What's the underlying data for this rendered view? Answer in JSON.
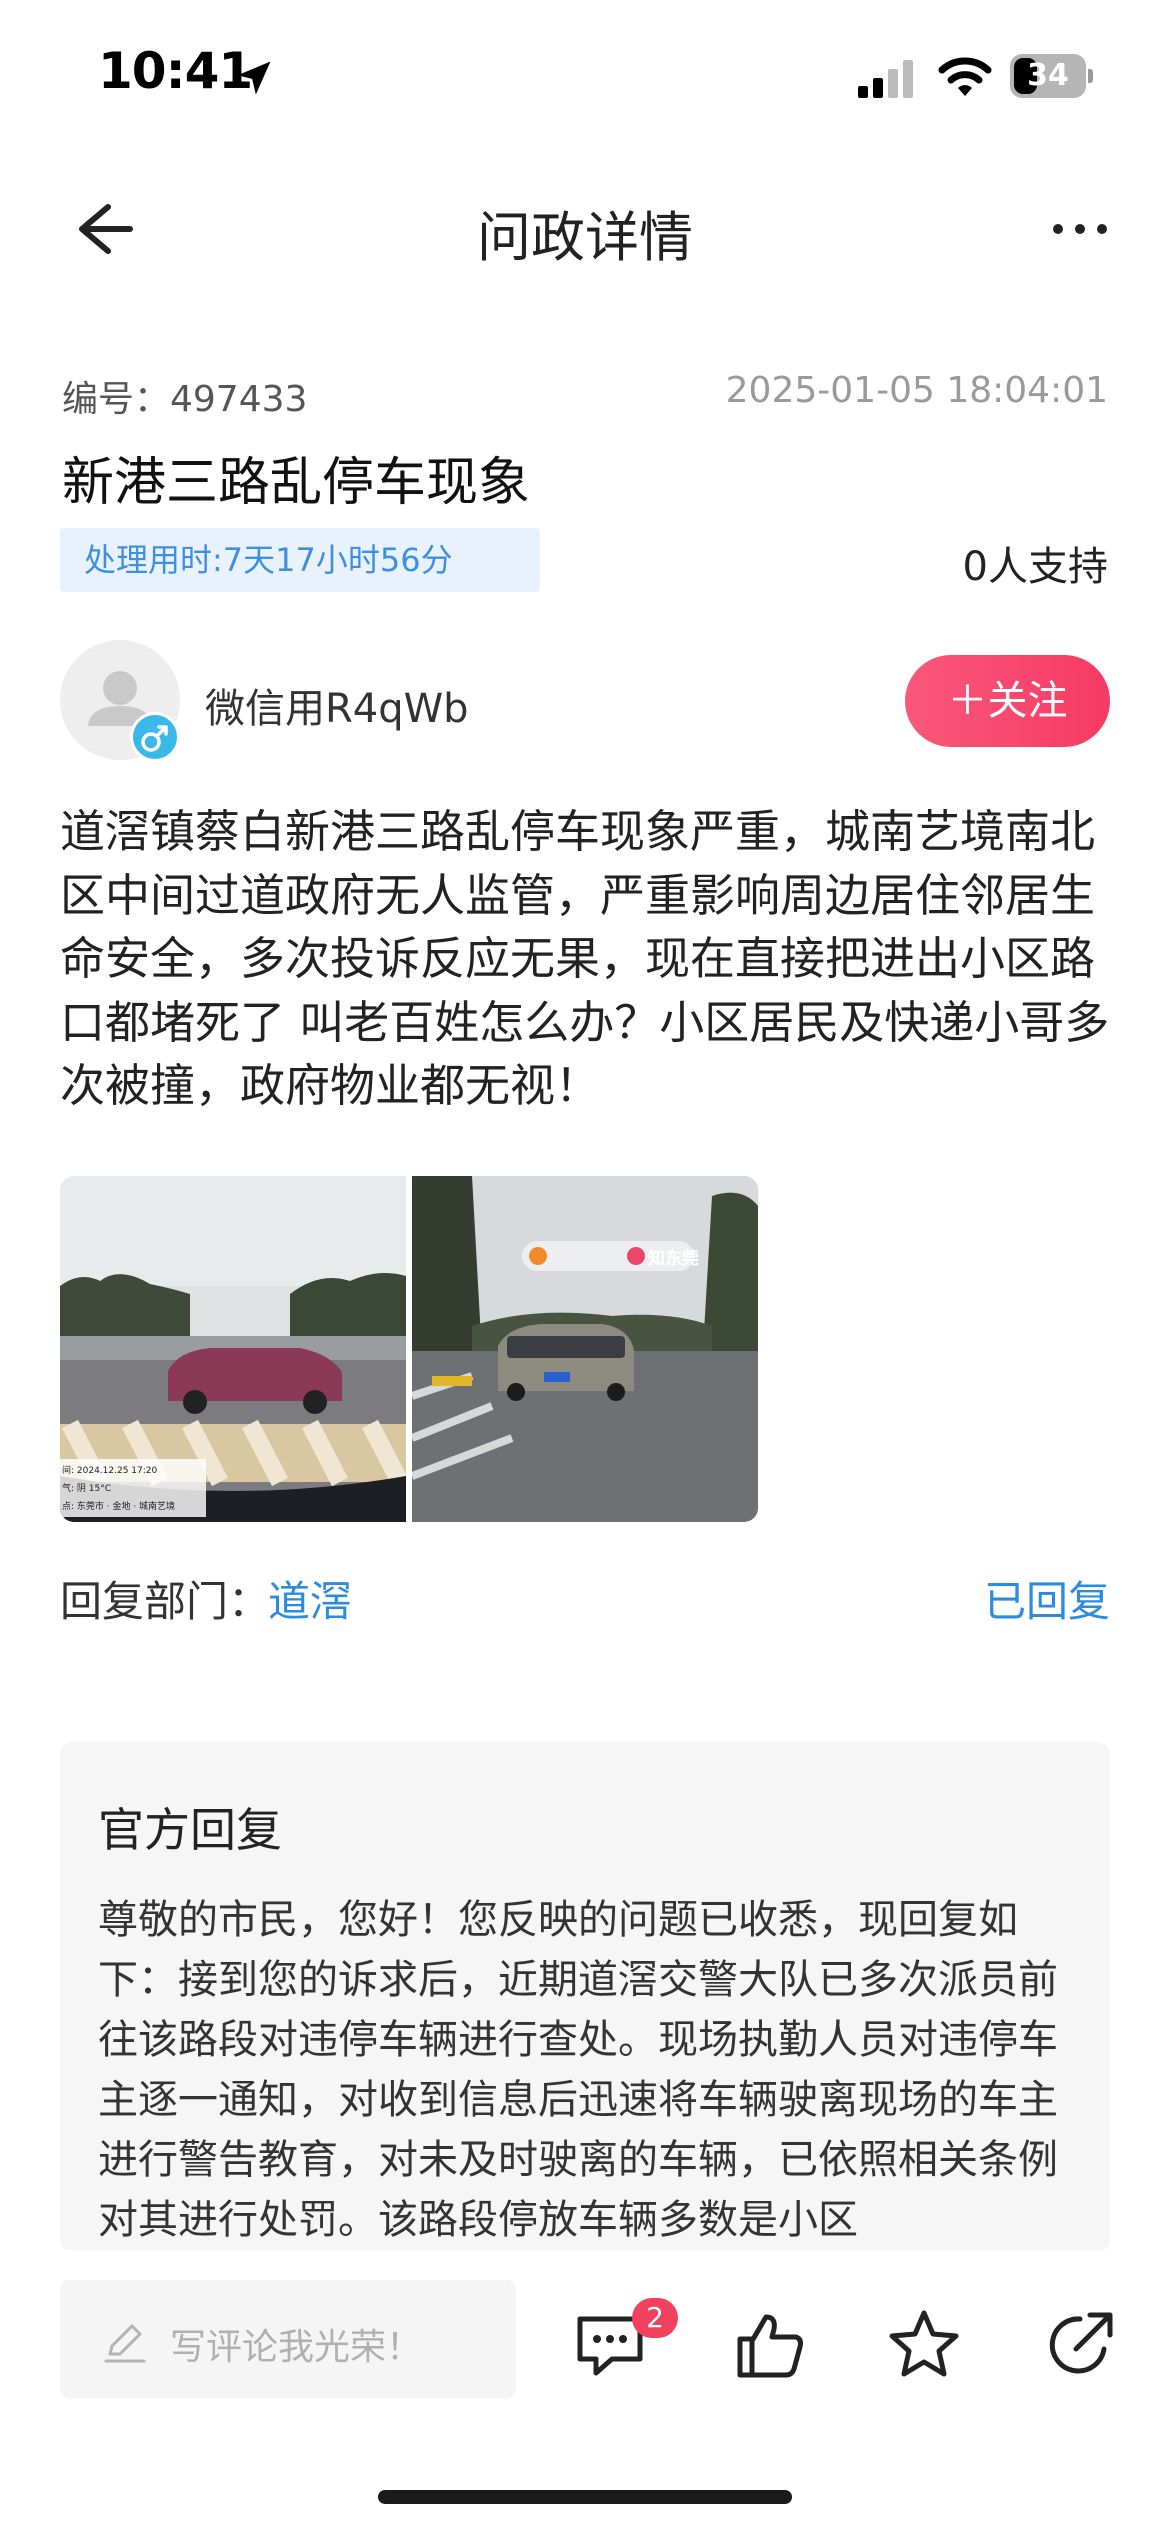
{
  "status_bar": {
    "time": "10:41",
    "battery_level": "34",
    "battery_fraction": 0.34
  },
  "nav": {
    "title": "问政详情"
  },
  "post": {
    "id_text": "编号：497433",
    "datetime": "2025-01-05 18:04:01",
    "title": "新港三路乱停车现象",
    "duration": "处理用时:7天17小时56分",
    "supporters": "0人支持",
    "author": {
      "name": "微信用R4qWb",
      "gender_icon": "male-icon"
    },
    "follow_label": "＋关注",
    "body": "道滘镇蔡白新港三路乱停车现象严重，城南艺境南北区中间过道政府无人监管，严重影响周边居住邻居生命安全，多次投诉反应无果，现在直接把进出小区路口都堵死了 叫老百姓怎么办？小区居民及快递小哥多次被撞，政府物业都无视！",
    "photos": [
      {
        "name": "photo-red-car",
        "caption_lines": [
          "间: 2024.12.25 17:20",
          "气: 阴 15°C",
          "点: 东莞市 · 金地 · 城南艺境"
        ]
      },
      {
        "name": "photo-silver-car",
        "watermark": "知东莞"
      }
    ]
  },
  "department": {
    "label": "回复部门：",
    "value": "道滘",
    "status": "已回复"
  },
  "official_reply": {
    "title": "官方回复",
    "body": "尊敬的市民，您好！您反映的问题已收悉，现回复如下：接到您的诉求后，近期道滘交警大队已多次派员前往该路段对违停车辆进行查处。现场执勤人员对违停车主逐一通知，对收到信息后迅速将车辆驶离现场的车主进行警告教育，对未及时驶离的车辆，已依照相关条例对其进行处罚。该路段停放车辆多数是小区"
  },
  "bottom_bar": {
    "comment_placeholder": "写评论我光荣！",
    "comment_count": "2"
  },
  "colors": {
    "accent_blue": "#2a8be0",
    "follow_pink": "#f73a62",
    "badge_red": "#f2405f"
  }
}
